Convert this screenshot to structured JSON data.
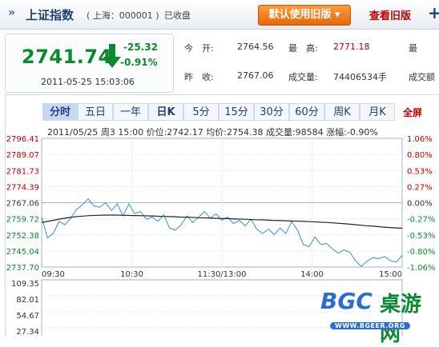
{
  "header": {
    "title": "上证指数",
    "subtitle": "( 上海：000001 )",
    "status": "已收盘",
    "default_button": "默认使用旧版",
    "old_version_link": "查看旧版",
    "plus": "+"
  },
  "quote": {
    "price": "2741.74",
    "change": "-25.32",
    "change_pct": "-0.91%",
    "timestamp": "2011-05-25 15:03:06"
  },
  "stats": {
    "open_label": "今　开:",
    "open": "2764.56",
    "high_label": "最　高:",
    "high": "2771.18",
    "low_label": "最",
    "prev_close_label": "昨　收:",
    "prev_close": "2767.06",
    "volume_label": "成交量:",
    "volume": "74406534手",
    "amount_label": "成交额"
  },
  "tabs": [
    "分时",
    "五日",
    "一年",
    "日K",
    "5分",
    "15分",
    "30分",
    "60分",
    "周K",
    "月K"
  ],
  "fullscreen": "全屏",
  "info_line": "2011/05/25 周3 15:00 价位:2742.17 均价:2754.38 成交量:98584 涨幅:-0.90%",
  "colors": {
    "up": "#c00000",
    "down": "#0b8a2c",
    "price_line": "#3a8fd0",
    "avg_line": "#222222"
  },
  "chart_data": {
    "type": "line",
    "y_left_ticks": [
      "2796.41",
      "2789.07",
      "2781.73",
      "2774.39",
      "2767.06",
      "2759.72",
      "2752.38",
      "2745.04",
      "2737.70"
    ],
    "y_right_ticks": [
      "1.06%",
      "0.80%",
      "0.53%",
      "0.27%",
      "0.00%",
      "-0.27%",
      "-0.53%",
      "-0.80%",
      "-1.06%"
    ],
    "x_ticks": [
      "09:30",
      "10:30",
      "11:30/13:00",
      "14:00",
      "15:00"
    ],
    "ylim": [
      2737.7,
      2796.41
    ],
    "series": [
      {
        "values": [
          2760.5,
          2751.0,
          2753.0,
          2758.5,
          2757.0,
          2760.0,
          2764.0,
          2766.0,
          2768.8,
          2765.5,
          2765.0,
          2767.0,
          2763.5,
          2766.5,
          2761.0,
          2766.5,
          2762.0,
          2763.0,
          2759.5,
          2760.5,
          2758.5,
          2761.5,
          2755.5,
          2754.5,
          2757.0,
          2761.0,
          2758.0,
          2760.5,
          2763.0,
          2760.0,
          2762.0,
          2759.0,
          2760.5,
          2757.5,
          2759.0,
          2756.5,
          2759.5,
          2755.0,
          2753.0,
          2755.0,
          2752.5,
          2755.5,
          2753.0,
          2758.5,
          2754.5,
          2748.0,
          2747.0,
          2751.5,
          2748.0,
          2748.5,
          2746.0,
          2744.0,
          2745.5,
          2744.5,
          2740.5,
          2738.0,
          2740.5,
          2742.0,
          2741.5,
          2742.5,
          2740.5,
          2740.0,
          2743.0
        ]
      },
      {
        "values": [
          2758.0,
          2758.8,
          2759.6,
          2760.3,
          2760.8,
          2761.1,
          2761.3,
          2761.4,
          2761.4,
          2761.3,
          2761.2,
          2761.1,
          2761.0,
          2760.8,
          2760.7,
          2760.5,
          2760.4,
          2760.2,
          2760.1,
          2759.9,
          2759.8,
          2759.6,
          2759.5,
          2759.3,
          2759.2,
          2759.0,
          2758.9,
          2758.7,
          2758.6,
          2758.4,
          2758.2,
          2758.0,
          2757.7,
          2757.4,
          2757.0,
          2756.6,
          2756.3,
          2755.9,
          2755.6,
          2755.4
        ]
      }
    ]
  },
  "volume_axis": [
    "109.35",
    "82.01",
    "54.67",
    "27.34"
  ],
  "watermark": {
    "brand": "BGC",
    "cn": "桌游网",
    "url": "WWW.BGEER.ORG"
  }
}
